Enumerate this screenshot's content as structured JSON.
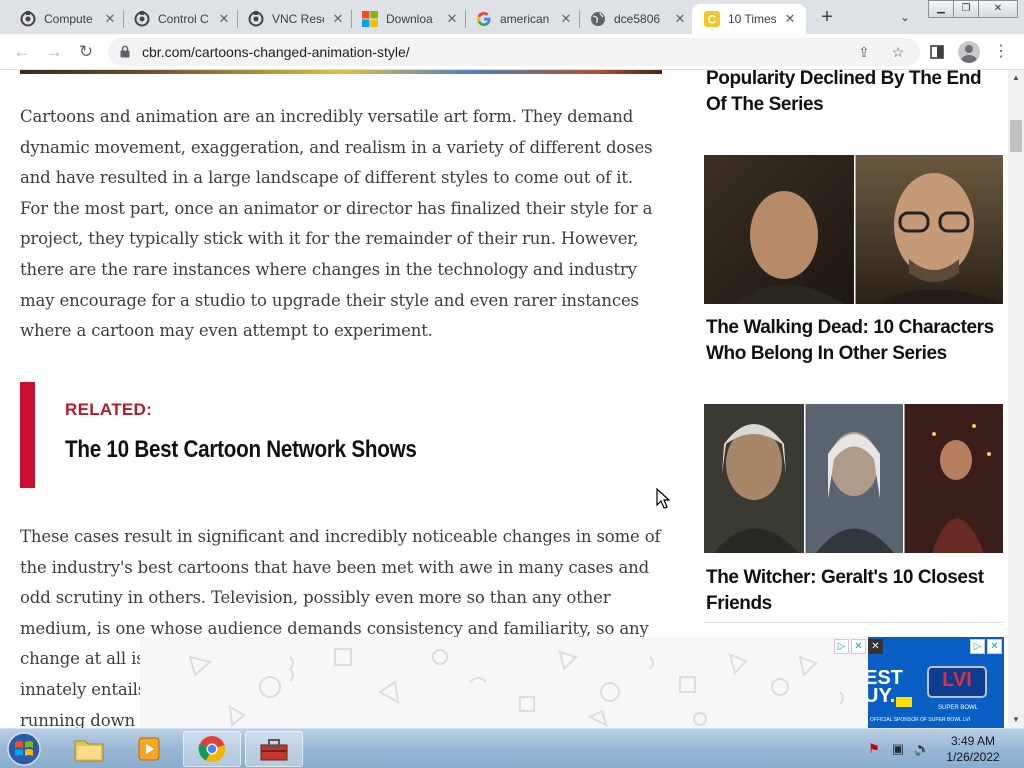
{
  "browser": {
    "tabs": [
      {
        "title": "Compute",
        "favicon": "vnc-icon"
      },
      {
        "title": "Control C",
        "favicon": "vnc-icon"
      },
      {
        "title": "VNC Rese",
        "favicon": "vnc-icon"
      },
      {
        "title": "Downloa",
        "favicon": "microsoft-icon"
      },
      {
        "title": "american",
        "favicon": "google-icon"
      },
      {
        "title": "dce5806",
        "favicon": "globe-icon"
      },
      {
        "title": "10 Times",
        "favicon": "cbr-icon",
        "active": true
      }
    ],
    "new_tab_label": "+",
    "url": "cbr.com/cartoons-changed-animation-style/"
  },
  "article": {
    "paragraph_1": "Cartoons and animation are an incredibly versatile art form. They demand dynamic movement, exaggeration, and realism in a variety of different doses and have resulted in a large landscape of different styles to come out of it. For the most part, once an animator or director has finalized their style for a project, they typically stick with it for the remainder of their run. However, there are the rare instances where changes in the technology and industry may encourage for a studio to upgrade their style and even rarer instances where a cartoon may even attempt to experiment.",
    "related_label": "RELATED:",
    "related_title": "The 10 Best Cartoon Network Shows",
    "paragraph_2": "These cases result in significant and incredibly noticeable changes in some of the industry's best cartoons that have been met with awe in many cases and odd scrutiny in others. Television, possibly even more so than any other medium, is one whose audience demands consistency and familiarity, so any change at all is at risk of aliena",
    "paragraph_2_line6": "innately entails",
    "paragraph_2_line7": "running down a"
  },
  "sidebar": {
    "items": [
      {
        "title": "Popularity Declined By The End Of The Series"
      },
      {
        "title": "The Walking Dead: 10 Characters Who Belong In Other Series"
      },
      {
        "title": "The Witcher: Geralt's 10 Closest Friends"
      }
    ]
  },
  "ad": {
    "right_text_1": "EST",
    "right_text_2": "UY.",
    "right_logo": "LVI",
    "right_sub": "SUPER BOWL",
    "right_footer": "OFFICIAL SPONSOR OF SUPER BOWL LVI"
  },
  "taskbar": {
    "time": "3:49 AM",
    "date": "1/26/2022"
  },
  "colors": {
    "related_accent": "#c8102e",
    "tab_strip": "#dee1e6",
    "taskbar": "#9bb8d6"
  }
}
